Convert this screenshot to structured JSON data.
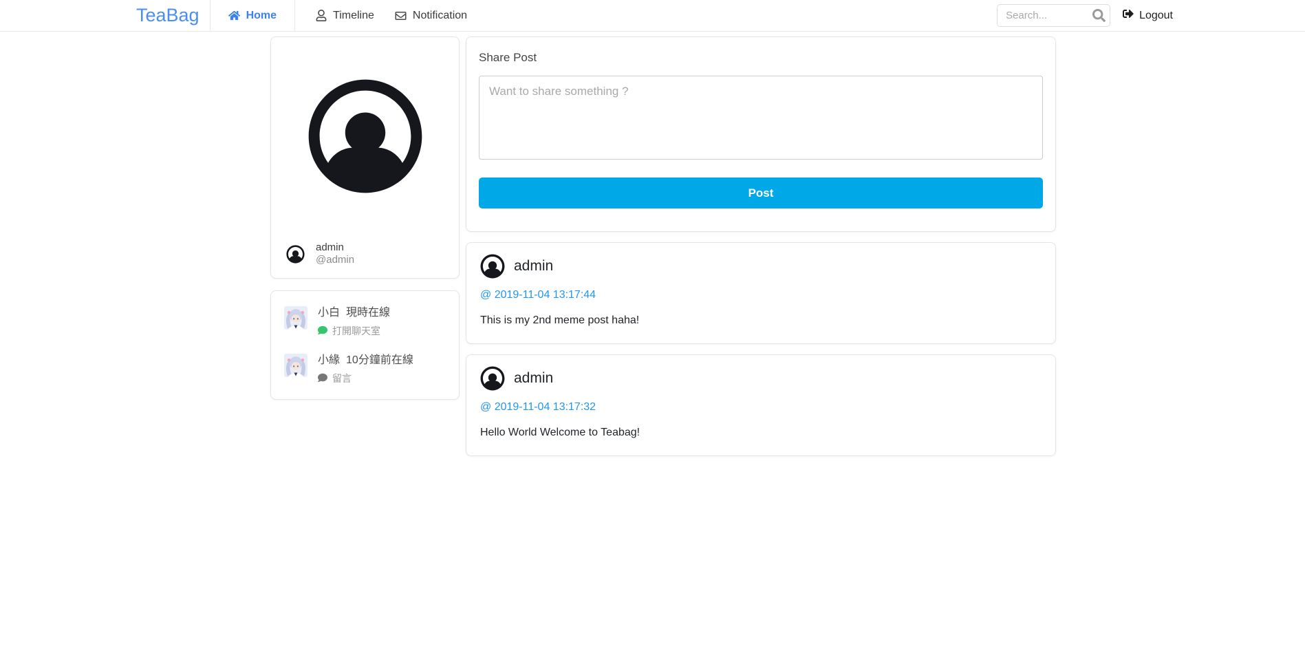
{
  "navbar": {
    "brand": "TeaBag",
    "home_label": "Home",
    "timeline_label": "Timeline",
    "notification_label": "Notification",
    "search_placeholder": "Search...",
    "logout_label": "Logout"
  },
  "profile": {
    "name": "admin",
    "handle": "@admin"
  },
  "friends": [
    {
      "name": "小白",
      "status": "現時在線",
      "action": "打開聊天室"
    },
    {
      "name": "小緣",
      "status": "10分鐘前在線",
      "action": "留言"
    }
  ],
  "share_post": {
    "title": "Share Post",
    "placeholder": "Want to share something ?",
    "post_button": "Post"
  },
  "posts": [
    {
      "author": "admin",
      "timestamp": "@ 2019-11-04 13:17:44",
      "body": "This is my 2nd meme post haha!"
    },
    {
      "author": "admin",
      "timestamp": "@ 2019-11-04 13:17:32",
      "body": "Hello World Welcome to Teabag!"
    }
  ],
  "icons": {
    "brand_nav": [
      "home-icon",
      "user-icon",
      "envelope-icon"
    ],
    "search": "search-icon",
    "logout": "sign-out-icon",
    "avatar": "user-circle-icon",
    "friend_action": "comment-icon"
  },
  "colors": {
    "brand_blue": "#4a8ff0",
    "active_nav_blue": "#3c82ec",
    "post_button_blue": "#00a8e8",
    "timestamp_link_blue": "#2196f3",
    "chat_bubble_green": "#34c56d",
    "comment_bubble_gray": "#777777"
  }
}
